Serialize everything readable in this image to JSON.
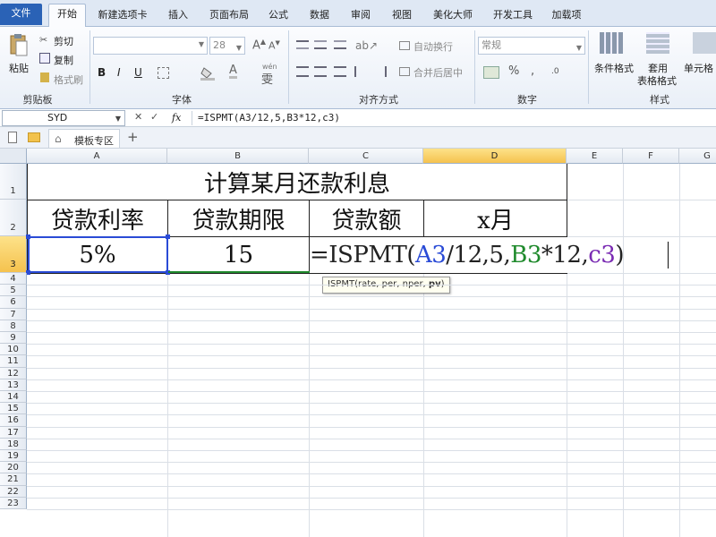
{
  "tabs": {
    "file": "文件",
    "home": "开始",
    "new_tab": "新建选项卡",
    "insert": "插入",
    "page_layout": "页面布局",
    "formulas": "公式",
    "data": "数据",
    "review": "审阅",
    "view": "视图",
    "beautify": "美化大师",
    "developer": "开发工具",
    "addins": "加载项"
  },
  "clipboard": {
    "paste": "粘贴",
    "cut": "剪切",
    "copy": "复制",
    "format_painter": "格式刷",
    "group": "剪贴板"
  },
  "font": {
    "name": "",
    "size": "28",
    "bold": "B",
    "italic": "I",
    "underline": "U",
    "group": "字体",
    "wen": "wén",
    "grow": "A",
    "shrink": "A",
    "font_color": "A",
    "pinyin": "雯"
  },
  "alignment": {
    "wrap": "自动换行",
    "merge": "合并后居中",
    "group": "对齐方式"
  },
  "number": {
    "format": "常规",
    "currency": "%",
    "comma": ",",
    "inc": ".0",
    "group": "数字"
  },
  "styles": {
    "cond": "条件格式",
    "table1": "套用",
    "table2": "表格格式",
    "cell": "单元格",
    "group": "样式"
  },
  "formula_bar": {
    "name_box": "SYD",
    "cancel": "✕",
    "enter": "✓",
    "fx": "fx",
    "formula": "=ISPMT(A3/12,5,B3*12,c3)"
  },
  "quick": {
    "template_tab": "模板专区",
    "add": "+"
  },
  "columns": [
    "A",
    "B",
    "C",
    "D",
    "E",
    "F",
    "G"
  ],
  "rows": [
    "1",
    "2",
    "3",
    "4",
    "5",
    "6",
    "7",
    "8",
    "9",
    "10",
    "11",
    "12",
    "13",
    "14",
    "15",
    "16",
    "17",
    "18",
    "19",
    "20",
    "21",
    "22",
    "23"
  ],
  "cells": {
    "title": "计算某月还款利息",
    "h_rate": "贷款利率",
    "h_term": "贷款期限",
    "h_amount": "贷款额",
    "h_month": "x月",
    "rate": "5%",
    "term": "15"
  },
  "editing": {
    "eq": "=ISPMT(",
    "ref_a": "A3",
    "mid1": "/12,5,",
    "ref_b": "B3",
    "mid2": "*12,",
    "ref_c": "c3",
    "close": ")",
    "tooltip_pre": "ISPMT(rate, per, nper, ",
    "tooltip_bold": "pv",
    ")": ")",
    "tooltip_post": ")"
  },
  "colors": {
    "ref_a": "#2a4bd6",
    "ref_b": "#1f8a2c",
    "ref_c": "#7a2bb3",
    "selected_header": "#f5c24e",
    "file_tab": "#2a62b6"
  }
}
